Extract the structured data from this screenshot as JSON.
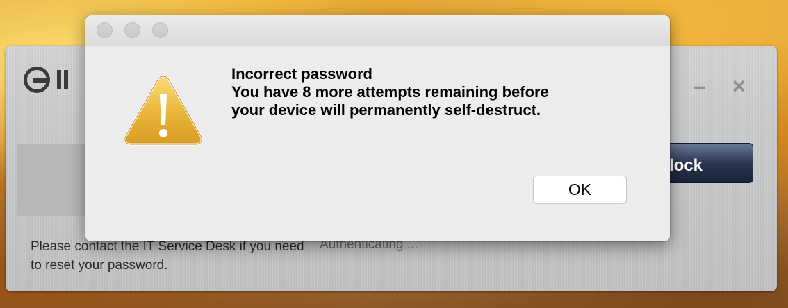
{
  "background_window": {
    "logo_text": "II",
    "help_text": "Please contact the IT Service Desk if you need to reset your password.",
    "status_text": "Authenticating ...",
    "unlock_button_label": "lock",
    "minimize_glyph": "–",
    "close_glyph": "×"
  },
  "dialog": {
    "icon": "warning-triangle-icon",
    "title": "Incorrect password",
    "message_lines": [
      "You have 8 more attempts remaining before",
      "your device will permanently self-destruct."
    ],
    "ok_label": "OK"
  },
  "colors": {
    "warning_icon_fill": "#e8b33a",
    "unlock_button": "#2a3550",
    "dialog_bg": "#ececec"
  }
}
